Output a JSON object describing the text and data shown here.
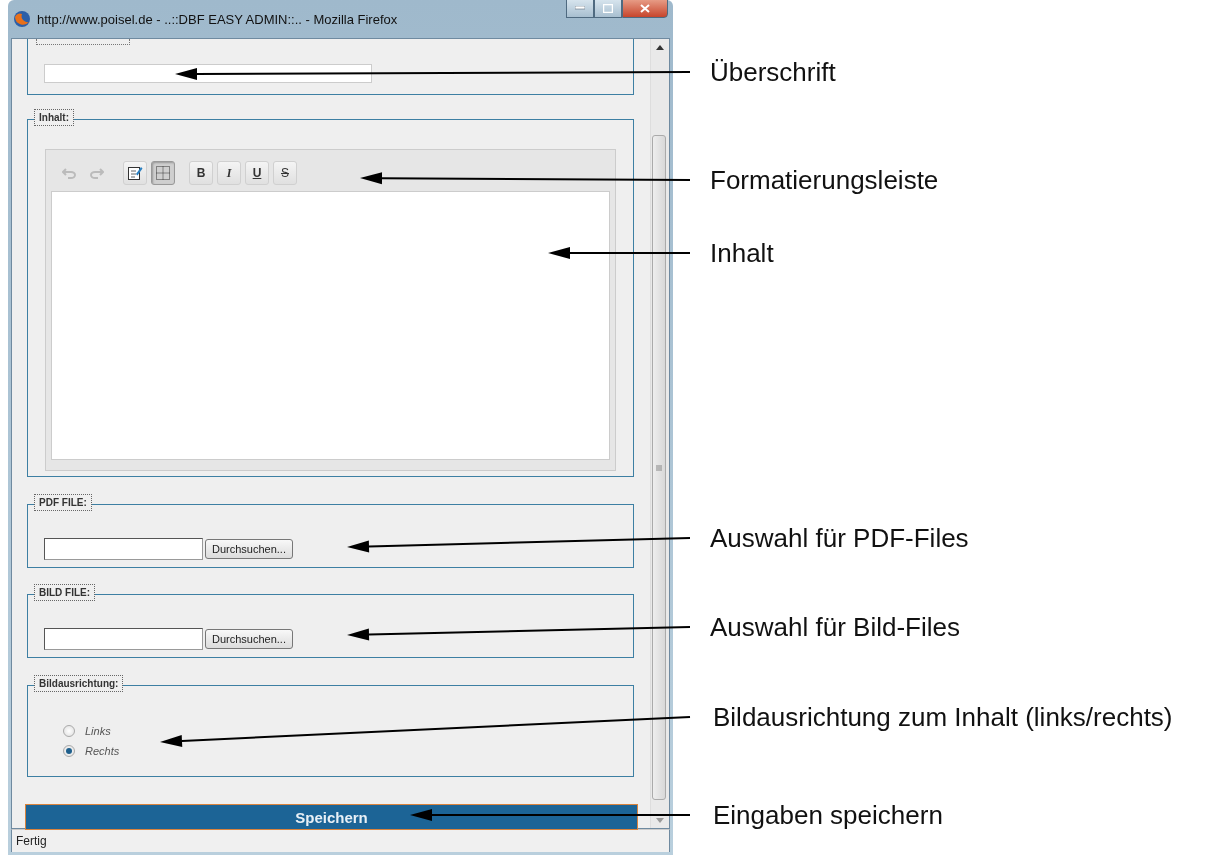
{
  "window": {
    "title": "http://www.poisel.de - ..::DBF EASY ADMIN::.. - Mozilla Firefox"
  },
  "content_section": {
    "legend": "Inhalt:",
    "toolbar": [
      {
        "kind": "undo",
        "disabled": true,
        "on": false
      },
      {
        "kind": "redo",
        "disabled": true,
        "on": false
      },
      {
        "kind": "edit",
        "disabled": false,
        "on": false
      },
      {
        "kind": "grid",
        "disabled": false,
        "on": true
      },
      {
        "kind": "bold",
        "label": "B",
        "disabled": false,
        "on": false
      },
      {
        "kind": "italic",
        "label": "I",
        "disabled": false,
        "on": false
      },
      {
        "kind": "underline",
        "label": "U",
        "disabled": false,
        "on": false
      },
      {
        "kind": "strike",
        "label": "S",
        "disabled": false,
        "on": false
      }
    ]
  },
  "pdf_file": {
    "legend": "PDF FILE:",
    "button": "Durchsuchen..."
  },
  "image_file": {
    "legend": "BILD FILE:",
    "button": "Durchsuchen..."
  },
  "alignment": {
    "legend": "Bildausrichtung:",
    "options": [
      {
        "label": "Links",
        "selected": false
      },
      {
        "label": "Rechts",
        "selected": true
      }
    ]
  },
  "save_button": "Speichern",
  "status_bar": "Fertig",
  "annotations": [
    {
      "text": "Überschrift"
    },
    {
      "text": "Formatierungsleiste"
    },
    {
      "text": "Inhalt"
    },
    {
      "text": "Auswahl für PDF-Files"
    },
    {
      "text": "Auswahl für Bild-Files"
    },
    {
      "text": "Bildausrichtung zum Inhalt (links/rechts)"
    },
    {
      "text": "Eingaben speichern"
    }
  ]
}
